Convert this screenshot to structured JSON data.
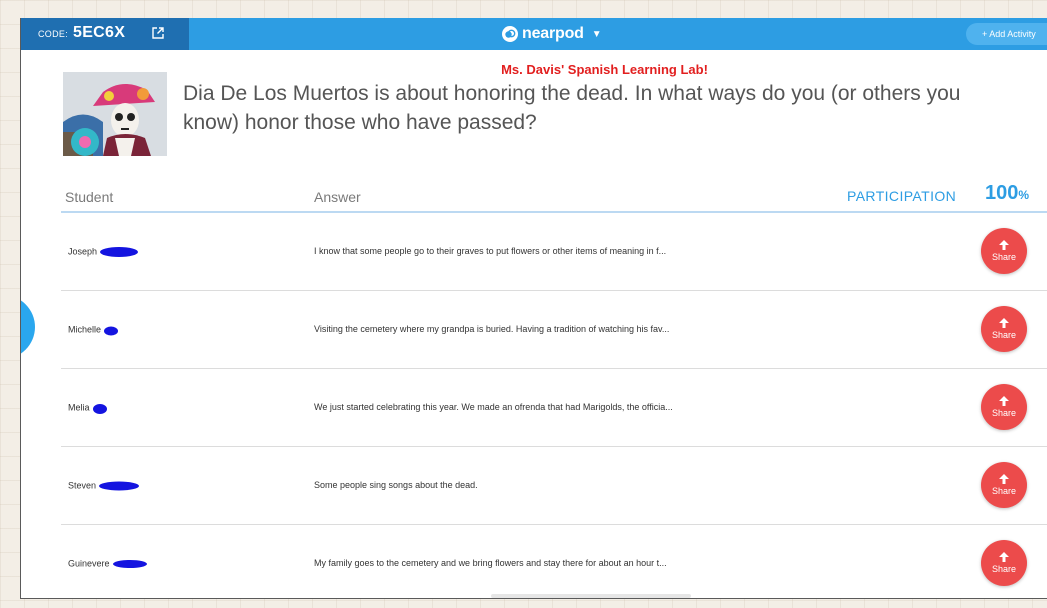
{
  "topbar": {
    "code_label": "CODE:",
    "code_value": "5EC6X",
    "logo_text": "nearpod",
    "add_activity_label": "+ Add Activity"
  },
  "lesson": {
    "lab_title": "Ms. Davis' Spanish Learning Lab!",
    "question": "Dia De Los Muertos is about honoring the dead.  In what ways do you (or others you know) honor those who have passed?"
  },
  "table": {
    "col_student": "Student",
    "col_answer": "Answer",
    "participation_label": "PARTICIPATION",
    "participation_value": "100",
    "participation_unit": "%",
    "rows": [
      {
        "student": "Joseph",
        "answer": "I know that some people go to their graves to put flowers or other items of meaning in f...",
        "share": "Share"
      },
      {
        "student": "Michelle",
        "answer": "Visiting the cemetery where my grandpa is buried. Having a tradition of watching his fav...",
        "share": "Share"
      },
      {
        "student": "Melia",
        "answer": "We just started celebrating this year. We made an ofrenda that had Marigolds, the officia...",
        "share": "Share"
      },
      {
        "student": "Steven",
        "answer": "Some people sing songs about the dead.",
        "share": "Share"
      },
      {
        "student": "Guinevere",
        "answer": "My family goes to the cemetery and we bring flowers and stay there for about an hour t...",
        "share": "Share"
      }
    ]
  },
  "colors": {
    "topbar": "#2d9de3",
    "code_box": "#1f6fb1",
    "accent": "#2d9de3",
    "share_button": "#ec4b4b",
    "lab_title": "#e21f1f",
    "redaction": "#1414e0"
  },
  "icons": {
    "code_link": "external-link-icon",
    "logo": "nearpod-logo-icon",
    "share": "arrow-up-icon"
  }
}
